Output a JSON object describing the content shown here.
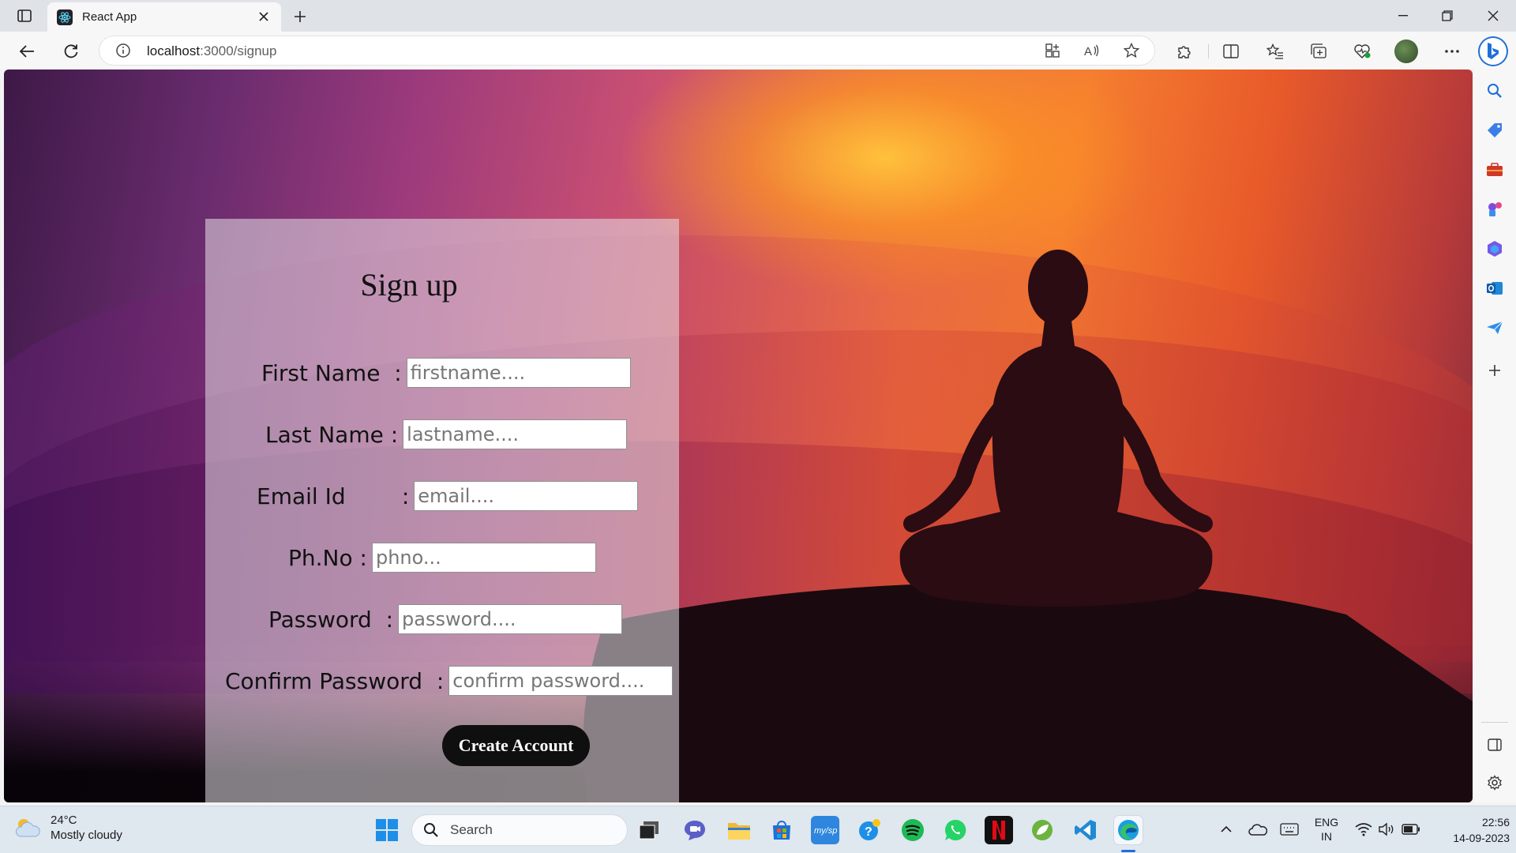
{
  "browser": {
    "tab_title": "React App",
    "url_host": "localhost",
    "url_rest": ":3000/signup"
  },
  "page": {
    "heading": "Sign up",
    "fields": [
      {
        "label": "First Name  :",
        "placeholder": "firstname...."
      },
      {
        "label": "Last Name :",
        "placeholder": "lastname...."
      },
      {
        "label": "Email Id        :",
        "placeholder": "email...."
      },
      {
        "label": "Ph.No :",
        "placeholder": "phno..."
      },
      {
        "label": "Password  :",
        "placeholder": "password...."
      },
      {
        "label": "Confirm Password  :",
        "placeholder": "confirm password...."
      }
    ],
    "submit_label": "Create Account"
  },
  "taskbar": {
    "temperature": "24°C",
    "weather": "Mostly cloudy",
    "search_label": "Search",
    "lang_top": "ENG",
    "lang_bottom": "IN",
    "time": "22:56",
    "date": "14-09-2023"
  },
  "icons": {
    "tab_toggle": "tab-actions-icon",
    "close": "close-icon",
    "new_tab": "plus-icon",
    "back": "back-arrow-icon",
    "reload": "reload-icon",
    "info": "info-icon",
    "read_aloud": "read-aloud-icon",
    "favorite": "star-icon",
    "extensions": "puzzle-icon",
    "split": "split-screen-icon",
    "favorites": "favorites-icon",
    "collections": "collections-icon",
    "health": "browser-essentials-icon",
    "more": "more-icon"
  }
}
